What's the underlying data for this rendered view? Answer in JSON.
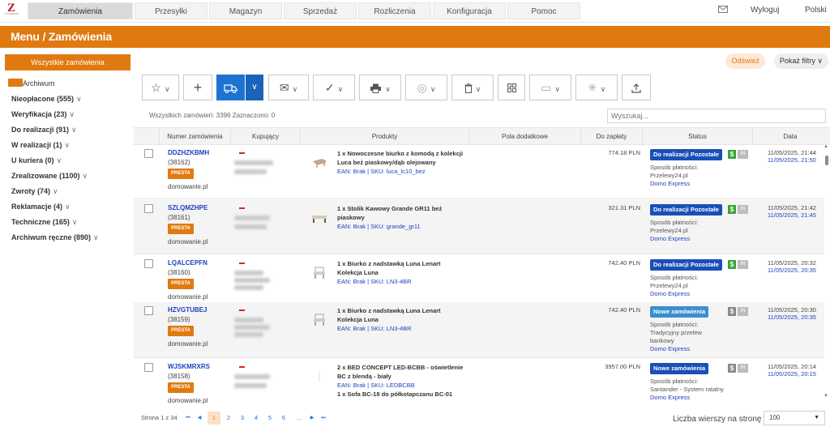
{
  "logo": {
    "mark": "Z",
    "text": "POSMESSN"
  },
  "topnav": {
    "tabs": [
      "Zamówienia",
      "Przesyłki",
      "Magazyn",
      "Sprzedaż",
      "Rozliczenia",
      "Konfiguracja",
      "Pomoc"
    ],
    "logout": "Wyloguj",
    "language": "Polski",
    "mail_icon": "mail-icon"
  },
  "header": {
    "title": "Menu / Zamówienia"
  },
  "sidebar": {
    "all_orders": "Wszystkie zamówienia",
    "archive": "Archiwum",
    "items": [
      {
        "label": "Nieopłacone (555)"
      },
      {
        "label": "Weryfikacja (23)"
      },
      {
        "label": "Do realizacji (91)"
      },
      {
        "label": "W realizacji (1)"
      },
      {
        "label": "U kuriera (0)"
      },
      {
        "label": "Zrealizowane (1100)"
      },
      {
        "label": "Zwroty (74)"
      },
      {
        "label": "Reklamacje (4)"
      },
      {
        "label": "Techniczne (165)"
      },
      {
        "label": "Archiwum ręczne (890)"
      }
    ]
  },
  "actions": {
    "refresh": "Odśwież",
    "filters": "Pokaż filtry",
    "filters_chevron": "∨"
  },
  "toolbar": {
    "buttons": [
      {
        "icon": "star-icon",
        "glyph": "☆"
      },
      {
        "icon": "plus-icon",
        "glyph": "+"
      },
      {
        "icon": "truck-icon",
        "glyph": "⛟"
      },
      {
        "icon": "mail-icon",
        "glyph": "✉"
      },
      {
        "icon": "check-icon",
        "glyph": "✓"
      },
      {
        "icon": "printer-icon",
        "glyph": "🖶"
      },
      {
        "icon": "coin-icon",
        "glyph": "◎"
      },
      {
        "icon": "trash-icon",
        "glyph": "🗑"
      },
      {
        "icon": "grid-icon",
        "glyph": "⊞"
      },
      {
        "icon": "scanner-icon",
        "glyph": "▭"
      },
      {
        "icon": "spark-icon",
        "glyph": "✳"
      },
      {
        "icon": "upload-icon",
        "glyph": "⇧"
      }
    ],
    "dropdown_glyph": "∨"
  },
  "summary": "Wszystkich zamówień: 3396 Zaznaczono: 0",
  "search": {
    "placeholder": "Wyszukaj..."
  },
  "table": {
    "columns": [
      "Numer zamówienia",
      "Kupujący",
      "Produkty",
      "Pola dodatkowe",
      "Do zapłaty",
      "Status",
      "Data"
    ],
    "rows": [
      {
        "order_no": "DDZHZKBMH",
        "id": "(38162)",
        "source": "PRESTA",
        "shop": "domowanie.pl",
        "product": "1 x Nowoczesne biurko z komodą z kolekcji Luca beż piaskowy/dąb olejowany",
        "meta": "EAN: Brak | SKU: luca_lc10_bez",
        "price": "774.18 PLN",
        "status": "Do realizacji Pozostałe",
        "status_style": "dark",
        "payment_label": "Sposób płatności:",
        "payment": "Przelewy24.pl",
        "shipping": "Domo Express",
        "paid": true,
        "date1": "11/05/2025, 21:44",
        "date2": "11/05/2025, 21:50"
      },
      {
        "order_no": "SZLQMZHPE",
        "id": "(38161)",
        "source": "PRESTA",
        "shop": "domowanie.pl",
        "product": "1 x Stolik Kawowy Grande GR11 beż piaskowy",
        "meta": "EAN: Brak | SKU: grande_gr11",
        "price": "321.31 PLN",
        "status": "Do realizacji Pozostałe",
        "status_style": "dark",
        "payment_label": "Sposób płatności:",
        "payment": "Przelewy24.pl",
        "shipping": "Domo Express",
        "paid": true,
        "date1": "11/05/2025, 21:42",
        "date2": "11/05/2025, 21:45"
      },
      {
        "order_no": "LQALCEPFN",
        "id": "(38160)",
        "source": "PRESTA",
        "shop": "domowanie.pl",
        "product": "1 x Biurko z nadstawką Luna Lenart Kolekcja Luna",
        "meta": "EAN: Brak | SKU: LN3-4BR",
        "price": "742.40 PLN",
        "status": "Do realizacji Pozostałe",
        "status_style": "dark",
        "payment_label": "Sposób płatności:",
        "payment": "Przelewy24.pl",
        "shipping": "Domo Express",
        "paid": true,
        "date1": "11/05/2025, 20:32",
        "date2": "11/05/2025, 20:35"
      },
      {
        "order_no": "HZVGTUBEJ",
        "id": "(38159)",
        "source": "PRESTA",
        "shop": "domowanie.pl",
        "product": "1 x Biurko z nadstawką Luna Lenart Kolekcja Luna",
        "meta": "EAN: Brak | SKU: LN3-4BR",
        "price": "742.40 PLN",
        "status": "Nowe zamówienia",
        "status_style": "light",
        "payment_label": "Sposób płatności:",
        "payment": "Tradycyjny przelew bankowy",
        "shipping": "Domo Express",
        "paid": false,
        "date1": "11/05/2025, 20:30",
        "date2": "11/05/2025, 20:35"
      },
      {
        "order_no": "WJSKMRXRS",
        "id": "(38158)",
        "source": "PRESTA",
        "shop": "domowanie.pl",
        "product": "2 x BED CONCEPT LED-BCBB - oświetlenie BC z blendą - biały",
        "meta": "EAN: Brak | SKU: LEDBCBB",
        "product2": "1 x Sofa BC-18 do półkotapczanu BC-01",
        "price": "3957.00 PLN",
        "status": "Nowe zamówienia",
        "status_style": "dark",
        "payment_label": "Sposób płatności:",
        "payment": "Santander - System ratalny",
        "shipping": "Domo Express",
        "paid": false,
        "date1": "11/05/2025, 20:14",
        "date2": "11/05/2025, 20:15"
      }
    ]
  },
  "pagination": {
    "label": "Strona 1 z 34",
    "first": "⏮",
    "prev": "◀",
    "next": "▶",
    "last": "⏭",
    "pages": [
      "1",
      "2",
      "3",
      "4",
      "5",
      "6"
    ],
    "ellipsis": "...",
    "current": "1",
    "rows_label": "Liczba wierszy na stronę",
    "rows_value": "100"
  },
  "colors": {
    "brand": "#e07a10",
    "link": "#1f3fbf",
    "status_dark": "#1a4fb8",
    "status_light": "#3a8fd0",
    "paid": "#3aa53a",
    "unpaid": "#8a8a8a"
  }
}
